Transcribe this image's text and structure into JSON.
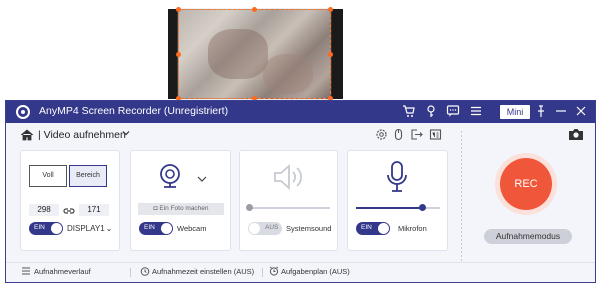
{
  "window": {
    "title": "AnyMP4 Screen Recorder (Unregistriert)",
    "mini_label": "Mini"
  },
  "subbar": {
    "title": "Video aufnehmen"
  },
  "display": {
    "full_label": "Voll",
    "area_label": "Bereich",
    "width": "298",
    "height": "171",
    "toggle_label": "EIN",
    "display_select": "DISPLAY1"
  },
  "webcam": {
    "photo_button": "Ein Foto machen",
    "toggle_label": "EIN",
    "label": "Webcam"
  },
  "system_sound": {
    "toggle_label": "AUS",
    "label": "Systemsound",
    "level": 0.0
  },
  "microphone": {
    "toggle_label": "EIN",
    "label": "Mikrofon",
    "level": 0.8
  },
  "rec": {
    "button_label": "REC",
    "mode_button": "Aufnahmemodus"
  },
  "footer": {
    "history": "Aufnahmeverlauf",
    "set_time": "Aufnahmezeit einstellen (AUS)",
    "schedule": "Aufgabenplan (AUS)"
  },
  "colors": {
    "accent": "#34388a",
    "rec": "#f0573a",
    "selection": "#ff7a2e"
  }
}
